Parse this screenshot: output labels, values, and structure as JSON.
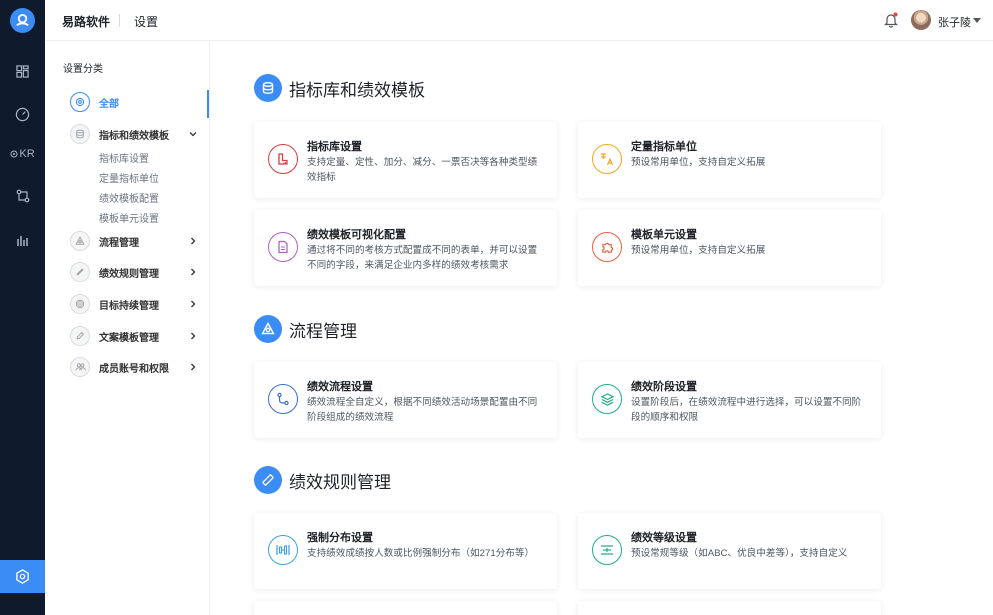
{
  "header": {
    "brand": "易路软件",
    "breadcrumb": "设置",
    "user_name": "张子陵"
  },
  "rail": {
    "items": [
      "dashboard-icon",
      "gauge-icon",
      "okr-icon",
      "flow-icon",
      "bar-chart-icon"
    ],
    "okr_label": "KR",
    "active": "settings-icon"
  },
  "sidebar": {
    "title": "设置分类",
    "items": [
      {
        "label": "全部",
        "active": true
      },
      {
        "label": "指标和绩效模板",
        "expanded": true
      },
      {
        "label": "流程管理"
      },
      {
        "label": "绩效规则管理"
      },
      {
        "label": "目标持续管理"
      },
      {
        "label": "文案模板管理"
      },
      {
        "label": "成员账号和权限"
      }
    ],
    "subitems": [
      "指标库设置",
      "定量指标单位",
      "绩效模板配置",
      "模板单元设置"
    ]
  },
  "sections": [
    {
      "title": "指标库和绩效模板"
    },
    {
      "title": "流程管理"
    },
    {
      "title": "绩效规则管理"
    }
  ],
  "cards": [
    {
      "title": "指标库设置",
      "desc": "支持定量、定性、加分、减分、一票否决等各种类型绩效指标",
      "icon": "ruler-icon",
      "color": "#e0393e"
    },
    {
      "title": "定量指标单位",
      "desc": "预设常用单位，支持自定义拓展",
      "icon": "translate-icon",
      "color": "#f5a623"
    },
    {
      "title": "绩效模板可视化配置",
      "desc": "通过将不同的考核方式配置成不同的表单，并可以设置不同的字段，来满足企业内多样的绩效考核需求",
      "icon": "document-icon",
      "color": "#b160c4"
    },
    {
      "title": "模板单元设置",
      "desc": "预设常用单位，支持自定义拓展",
      "icon": "puzzle-icon",
      "color": "#e8603c"
    },
    {
      "title": "绩效流程设置",
      "desc": "绩效流程全自定义，根据不同绩效活动场景配置由不同阶段组成的绩效流程",
      "icon": "route-icon",
      "color": "#3c6fd1"
    },
    {
      "title": "绩效阶段设置",
      "desc": "设置阶段后，在绩效流程中进行选择，可以设置不同阶段的顺序和权限",
      "icon": "layers-icon",
      "color": "#22b07d"
    },
    {
      "title": "强制分布设置",
      "desc": "支持绩效成绩按人数或比例强制分布（如271分布等）",
      "icon": "distribution-icon",
      "color": "#3aa0e6"
    },
    {
      "title": "绩效等级设置",
      "desc": "预设常规等级（如ABC、优良中差等），支持自定义",
      "icon": "grade-icon",
      "color": "#22b07d"
    }
  ]
}
